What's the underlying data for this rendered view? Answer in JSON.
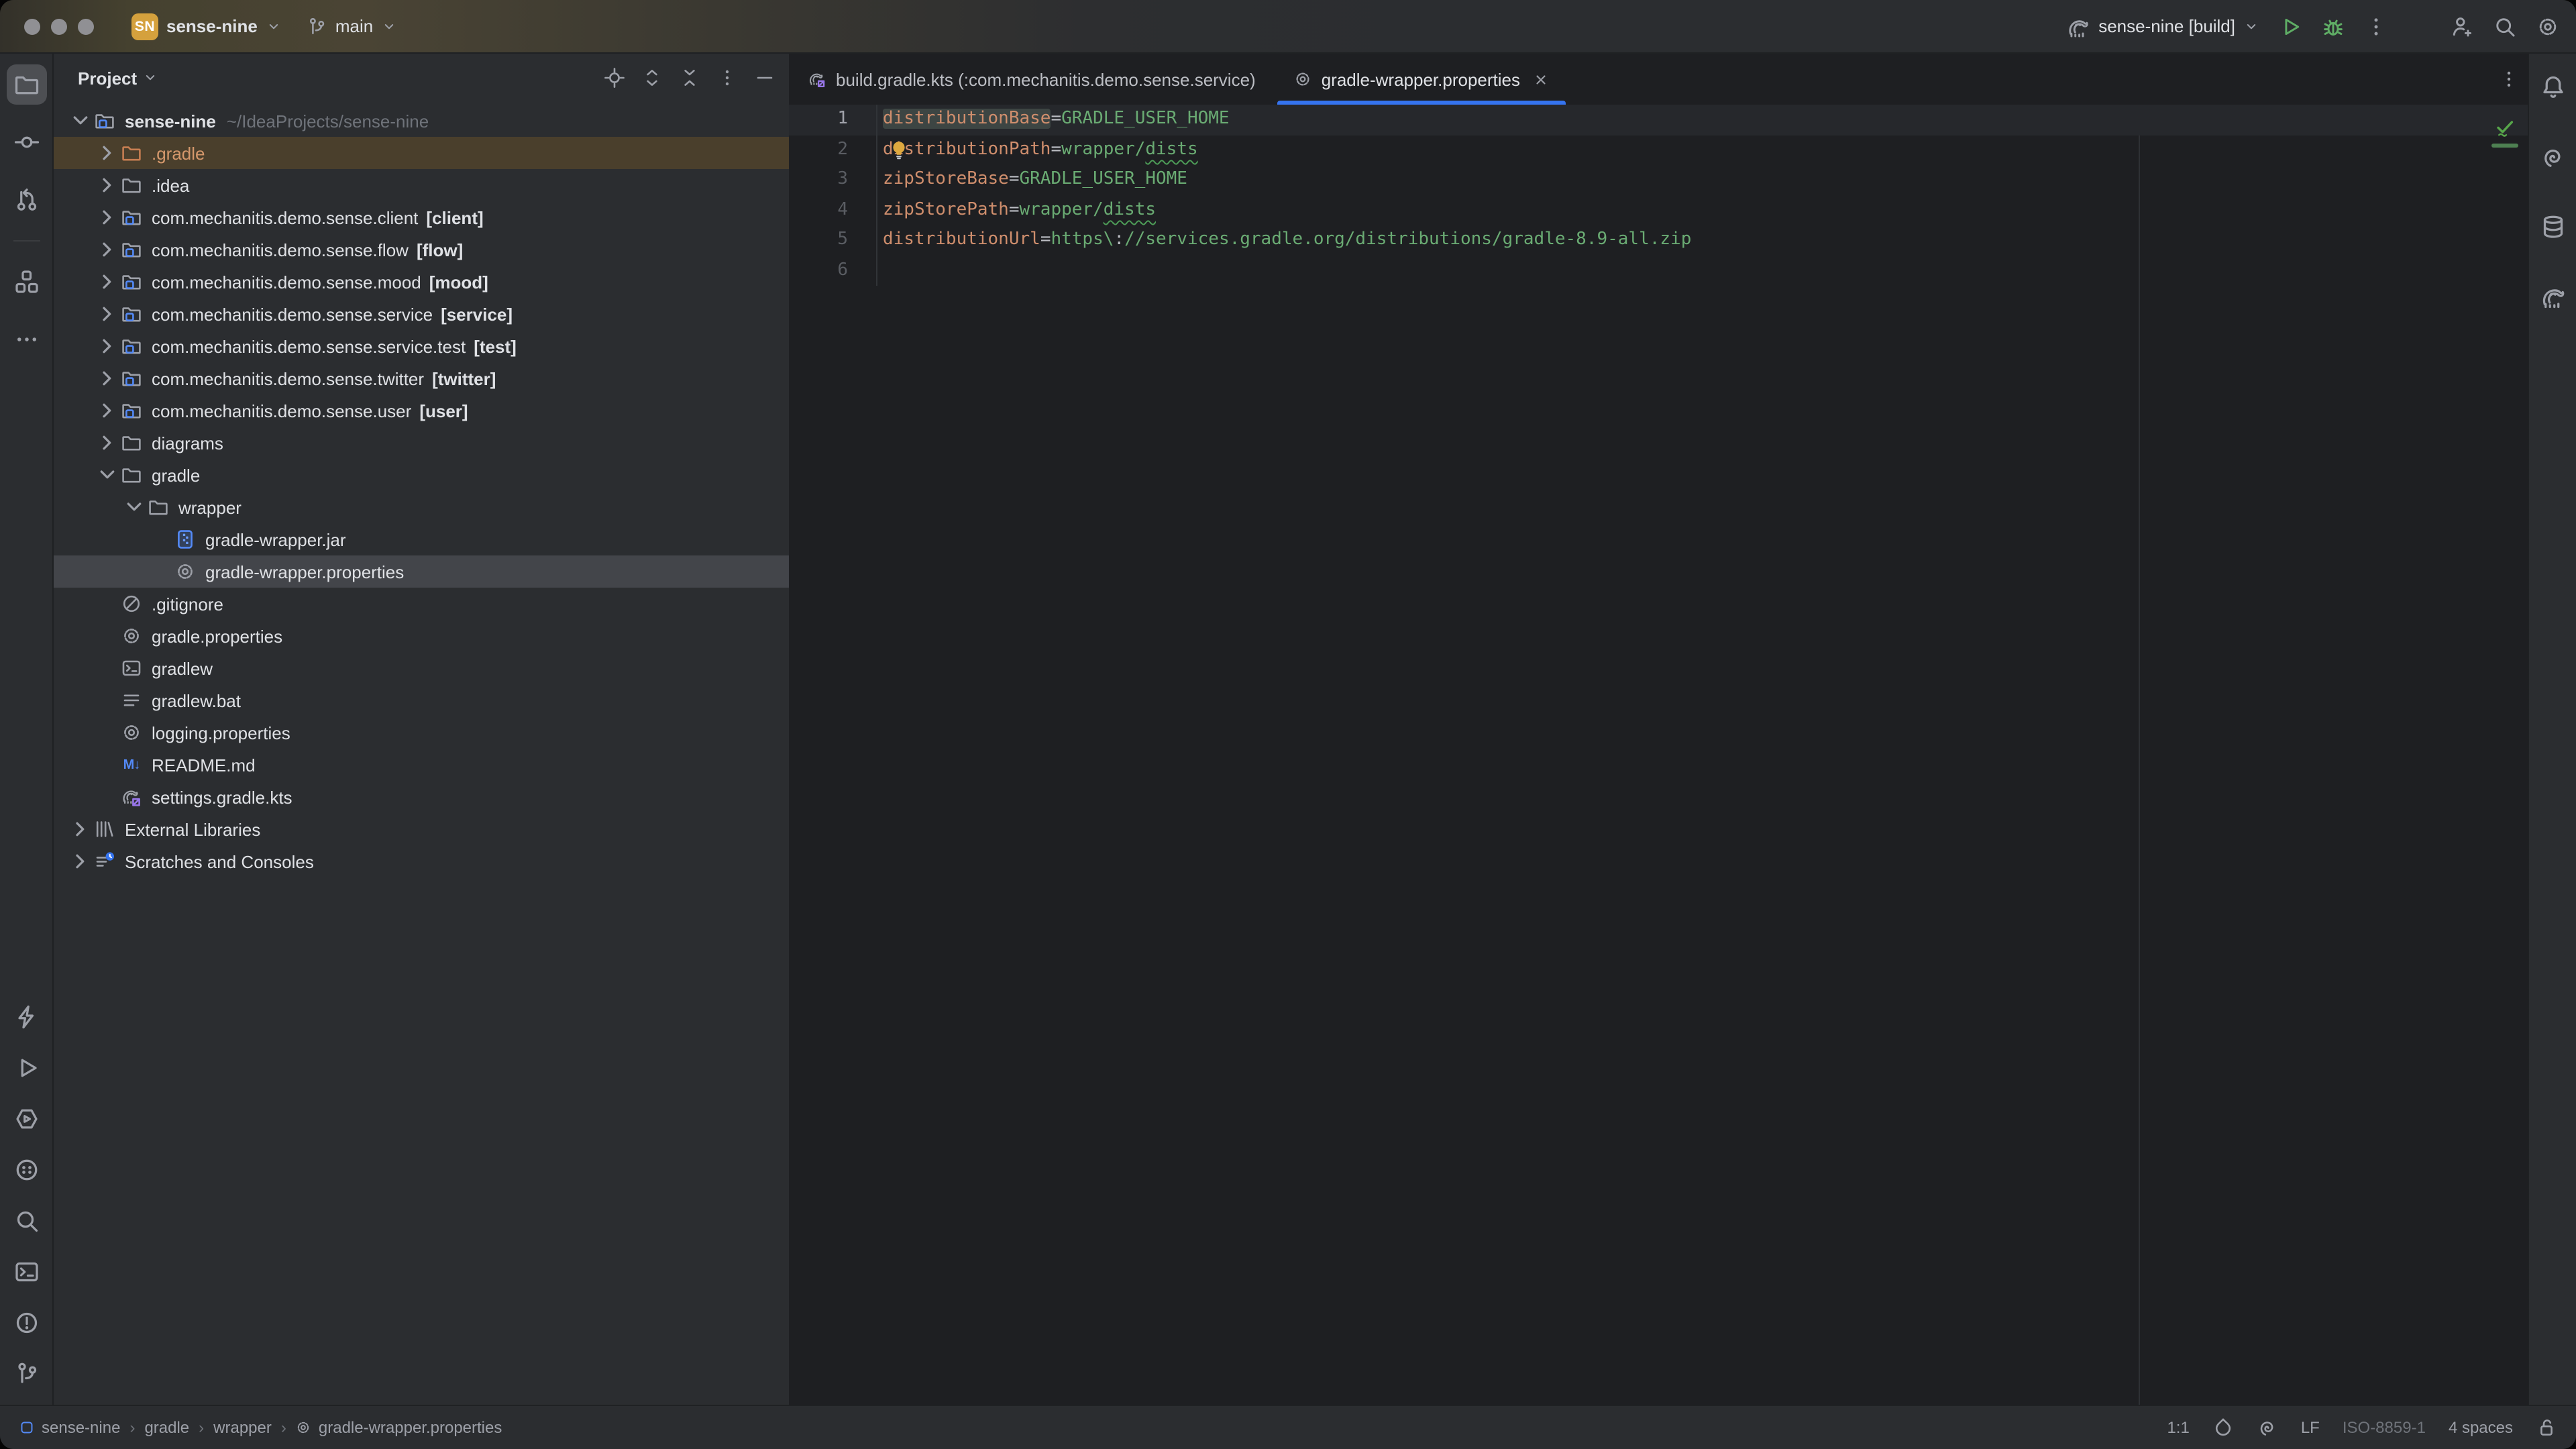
{
  "titlebar": {
    "badge": "SN",
    "project": "sense-nine",
    "branch": "main",
    "run_config": "sense-nine [build]"
  },
  "project_panel": {
    "title": "Project"
  },
  "strips": {
    "left_top": [
      {
        "icon": "folder",
        "name": "project-tool",
        "active": true
      },
      {
        "icon": "commit",
        "name": "commit-tool"
      },
      {
        "icon": "pull-requests",
        "name": "pull-requests-tool"
      },
      {
        "divider": true
      },
      {
        "icon": "structure",
        "name": "structure-tool"
      },
      {
        "icon": "more-horizontal",
        "name": "more-tool-windows"
      }
    ],
    "left_bottom": [
      {
        "icon": "bolt",
        "name": "endpoints-tool"
      },
      {
        "icon": "run",
        "name": "run-tool"
      },
      {
        "icon": "services",
        "name": "services-tool"
      },
      {
        "icon": "dotted-circle",
        "name": "build-tool"
      },
      {
        "icon": "search",
        "name": "search-everywhere"
      },
      {
        "icon": "terminal",
        "name": "terminal-tool"
      },
      {
        "icon": "problems",
        "name": "problems-tool"
      },
      {
        "icon": "git-branch",
        "name": "version-control-tool"
      }
    ],
    "right": [
      {
        "icon": "notifications",
        "name": "notifications"
      },
      {
        "icon": "ai-assistant",
        "name": "ai-assistant"
      },
      {
        "icon": "database",
        "name": "database-tool"
      },
      {
        "icon": "gradle",
        "name": "gradle-tool"
      }
    ]
  },
  "tree": {
    "items": [
      {
        "level": 0,
        "chev": "open",
        "icon": "folder-project",
        "name": "sense-nine",
        "bold": true,
        "hint": "~/IdeaProjects/sense-nine"
      },
      {
        "level": 1,
        "chev": "closed",
        "icon": "folder-excluded",
        "name": ".gradle",
        "selected": "warm"
      },
      {
        "level": 1,
        "chev": "closed",
        "icon": "folder",
        "name": ".idea"
      },
      {
        "level": 1,
        "chev": "closed",
        "icon": "folder-module",
        "name": "com.mechanitis.demo.sense.client",
        "mod": "[client]"
      },
      {
        "level": 1,
        "chev": "closed",
        "icon": "folder-module",
        "name": "com.mechanitis.demo.sense.flow",
        "mod": "[flow]"
      },
      {
        "level": 1,
        "chev": "closed",
        "icon": "folder-module",
        "name": "com.mechanitis.demo.sense.mood",
        "mod": "[mood]"
      },
      {
        "level": 1,
        "chev": "closed",
        "icon": "folder-module",
        "name": "com.mechanitis.demo.sense.service",
        "mod": "[service]"
      },
      {
        "level": 1,
        "chev": "closed",
        "icon": "folder-module",
        "name": "com.mechanitis.demo.sense.service.test",
        "mod": "[test]"
      },
      {
        "level": 1,
        "chev": "closed",
        "icon": "folder-module",
        "name": "com.mechanitis.demo.sense.twitter",
        "mod": "[twitter]"
      },
      {
        "level": 1,
        "chev": "closed",
        "icon": "folder-module",
        "name": "com.mechanitis.demo.sense.user",
        "mod": "[user]"
      },
      {
        "level": 1,
        "chev": "closed",
        "icon": "folder",
        "name": "diagrams"
      },
      {
        "level": 1,
        "chev": "open",
        "icon": "folder",
        "name": "gradle"
      },
      {
        "level": 2,
        "chev": "open",
        "icon": "folder",
        "name": "wrapper"
      },
      {
        "level": 3,
        "icon": "jar",
        "name": "gradle-wrapper.jar"
      },
      {
        "level": 3,
        "icon": "gear",
        "name": "gradle-wrapper.properties",
        "selected": "active"
      },
      {
        "level": 1,
        "icon": "gitignore",
        "name": ".gitignore"
      },
      {
        "level": 1,
        "icon": "gear",
        "name": "gradle.properties"
      },
      {
        "level": 1,
        "icon": "terminal-file",
        "name": "gradlew"
      },
      {
        "level": 1,
        "icon": "lines",
        "name": "gradlew.bat"
      },
      {
        "level": 1,
        "icon": "gear",
        "name": "logging.properties"
      },
      {
        "level": 1,
        "icon": "markdown",
        "name": "README.md"
      },
      {
        "level": 1,
        "icon": "gradle-kts",
        "name": "settings.gradle.kts"
      },
      {
        "level": 0,
        "chev": "closed",
        "icon": "libraries",
        "name": "External Libraries"
      },
      {
        "level": 0,
        "chev": "closed",
        "icon": "scratches",
        "name": "Scratches and Consoles"
      }
    ]
  },
  "tabs": [
    {
      "label": "build.gradle.kts (:com.mechanitis.demo.sense.service)",
      "icon": "gradle-kts",
      "active": false,
      "close": false
    },
    {
      "label": "gradle-wrapper.properties",
      "icon": "gear",
      "active": true,
      "close": true
    }
  ],
  "editor": {
    "lines": [
      {
        "n": "1",
        "current": true,
        "seg": [
          {
            "t": "distributionBase",
            "c": "key hl"
          },
          {
            "t": "=",
            "c": "op"
          },
          {
            "t": "GRADLE_USER_HOME",
            "c": "val"
          }
        ]
      },
      {
        "n": "2",
        "bulb": true,
        "seg": [
          {
            "t": "distributionPath",
            "c": "key"
          },
          {
            "t": "=",
            "c": "op"
          },
          {
            "t": "wrapper/",
            "c": "val"
          },
          {
            "t": "dists",
            "c": "val typo"
          }
        ]
      },
      {
        "n": "3",
        "seg": [
          {
            "t": "zipStoreBase",
            "c": "key"
          },
          {
            "t": "=",
            "c": "op"
          },
          {
            "t": "GRADLE_USER_HOME",
            "c": "val"
          }
        ]
      },
      {
        "n": "4",
        "seg": [
          {
            "t": "zipStorePath",
            "c": "key"
          },
          {
            "t": "=",
            "c": "op"
          },
          {
            "t": "wrapper/",
            "c": "val"
          },
          {
            "t": "dists",
            "c": "val typo"
          }
        ]
      },
      {
        "n": "5",
        "seg": [
          {
            "t": "distributionUrl",
            "c": "key"
          },
          {
            "t": "=",
            "c": "op"
          },
          {
            "t": "https",
            "c": "val"
          },
          {
            "t": "\\",
            "c": "val"
          },
          {
            "t": ":",
            "c": "op"
          },
          {
            "t": "//services.gradle.org/distributions/gradle-8.9-all.zip",
            "c": "val"
          }
        ]
      },
      {
        "n": "6",
        "seg": []
      }
    ]
  },
  "statusbar": {
    "breadcrumbs": [
      {
        "label": "sense-nine",
        "icon": "crumb-project"
      },
      {
        "label": "gradle"
      },
      {
        "label": "wrapper"
      },
      {
        "label": "gradle-wrapper.properties",
        "icon": "gear"
      }
    ],
    "caret": "1:1",
    "line_ending": "LF",
    "encoding": "ISO-8859-1",
    "indent": "4 spaces"
  },
  "colors": {
    "accent": "#3574f0",
    "run_green": "#5fad65",
    "property_key": "#cf8e6d",
    "property_value": "#6aab73",
    "project_badge": "#d5a13d",
    "excluded_folder": "#c77e52",
    "selection": "#43454a"
  }
}
